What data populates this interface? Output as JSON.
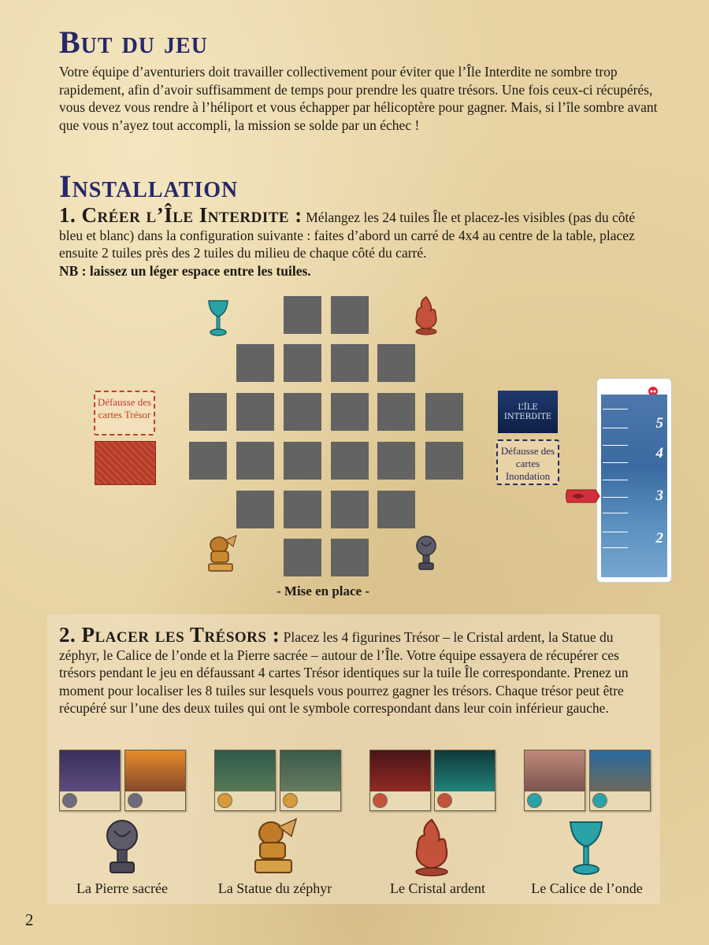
{
  "goal": {
    "title": "But du jeu",
    "text": "Votre équipe d’aventuriers doit travailler collectivement pour éviter que l’Île Interdite ne sombre trop rapidement, afin d’avoir suffisamment de temps pour prendre les quatre trésors. Une fois ceux-ci récupérés, vous devez vous rendre à l’héliport et vous échapper par hélicoptère pour gagner. Mais, si l’île sombre avant que vous n’ayez tout accompli, la mission se solde par un échec !"
  },
  "installation": {
    "title": "Installation",
    "step1_title": "1. Créer l’Île Interdite :",
    "step1_text": " Mélangez les 24 tuiles Île et placez-les visibles (pas du côté bleu et blanc) dans la configuration suivante : faites d’abord un carré de 4x4 au centre de la table, placez ensuite 2 tuiles près des 2 tuiles du milieu de chaque côté du carré.",
    "step1_note": "NB : laissez un léger espace entre les tuiles."
  },
  "setup_figure": {
    "caption": "- Mise en place -",
    "treasure_discard": "Défausse des cartes Trésor",
    "flood_discard": "Défausse des cartes Inondation",
    "flood_deck_title": "L’ÎLE INTERDITE",
    "meter_levels": [
      "5",
      "4",
      "3",
      "2"
    ],
    "meter_marker_level": 3,
    "colors": {
      "tile": "#636363",
      "treasure_red": "#c3402c",
      "flood_navy": "#27295e"
    }
  },
  "treasures": {
    "step2_title": "2. Placer les Trésors :",
    "step2_text": " Placez les 4 figurines Trésor – le Cristal ardent, la Statue du zéphyr, le Calice de l’onde et la Pierre sacrée – autour de l’Île. Votre équipe essayera de récupérer ces trésors pendant le jeu en défaussant 4 cartes Trésor identiques sur la tuile Île correspondante. Prenez un moment pour localiser les 8 tuiles sur lesquels vous pourrez gagner les trésors. Chaque trésor peut être récupéré sur l’une des deux tuiles qui ont le symbole correspondant dans leur coin inférieur gauche.",
    "figures": [
      {
        "name": "La Pierre sacrée",
        "icon": "stone-icon"
      },
      {
        "name": "La Statue du zéphyr",
        "icon": "lion-statue-icon"
      },
      {
        "name": "Le Cristal ardent",
        "icon": "fire-crystal-icon"
      },
      {
        "name": "Le Calice de l’onde",
        "icon": "chalice-icon"
      }
    ]
  },
  "page_number": "2"
}
